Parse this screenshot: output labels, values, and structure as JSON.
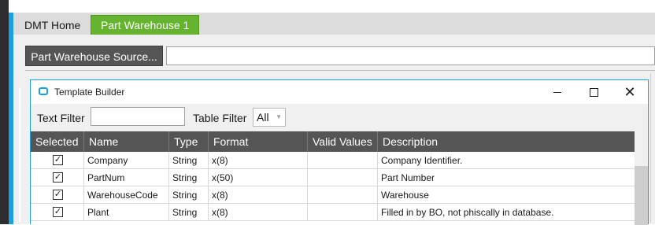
{
  "tabs": [
    {
      "label": "DMT Home",
      "active": false
    },
    {
      "label": "Part Warehouse 1",
      "active": true
    }
  ],
  "source_button_label": "Part Warehouse Source...",
  "source_input_value": "",
  "dialog": {
    "title": "Template Builder",
    "text_filter_label": "Text Filter",
    "text_filter_value": "",
    "table_filter_label": "Table Filter",
    "table_filter_value": "All",
    "columns": [
      "Selected",
      "Name",
      "Type",
      "Format",
      "Valid Values",
      "Description"
    ],
    "rows": [
      {
        "selected": true,
        "name": "Company",
        "type": "String",
        "format": "x(8)",
        "valid_values": "",
        "description": "Company Identifier."
      },
      {
        "selected": true,
        "name": "PartNum",
        "type": "String",
        "format": "x(50)",
        "valid_values": "",
        "description": "Part Number"
      },
      {
        "selected": true,
        "name": "WarehouseCode",
        "type": "String",
        "format": "x(8)",
        "valid_values": "",
        "description": "Warehouse"
      },
      {
        "selected": true,
        "name": "Plant",
        "type": "String",
        "format": "x(8)",
        "valid_values": "",
        "description": "Filled in by BO, not phiscally in database."
      }
    ]
  },
  "colors": {
    "accent": "#1ba1e2",
    "active_tab": "#65b32e",
    "header_bg": "#555555"
  },
  "icons": [
    "app-window-icon",
    "minimize-icon",
    "maximize-icon",
    "close-icon",
    "checkmark-icon",
    "dropdown-arrow-icon"
  ]
}
